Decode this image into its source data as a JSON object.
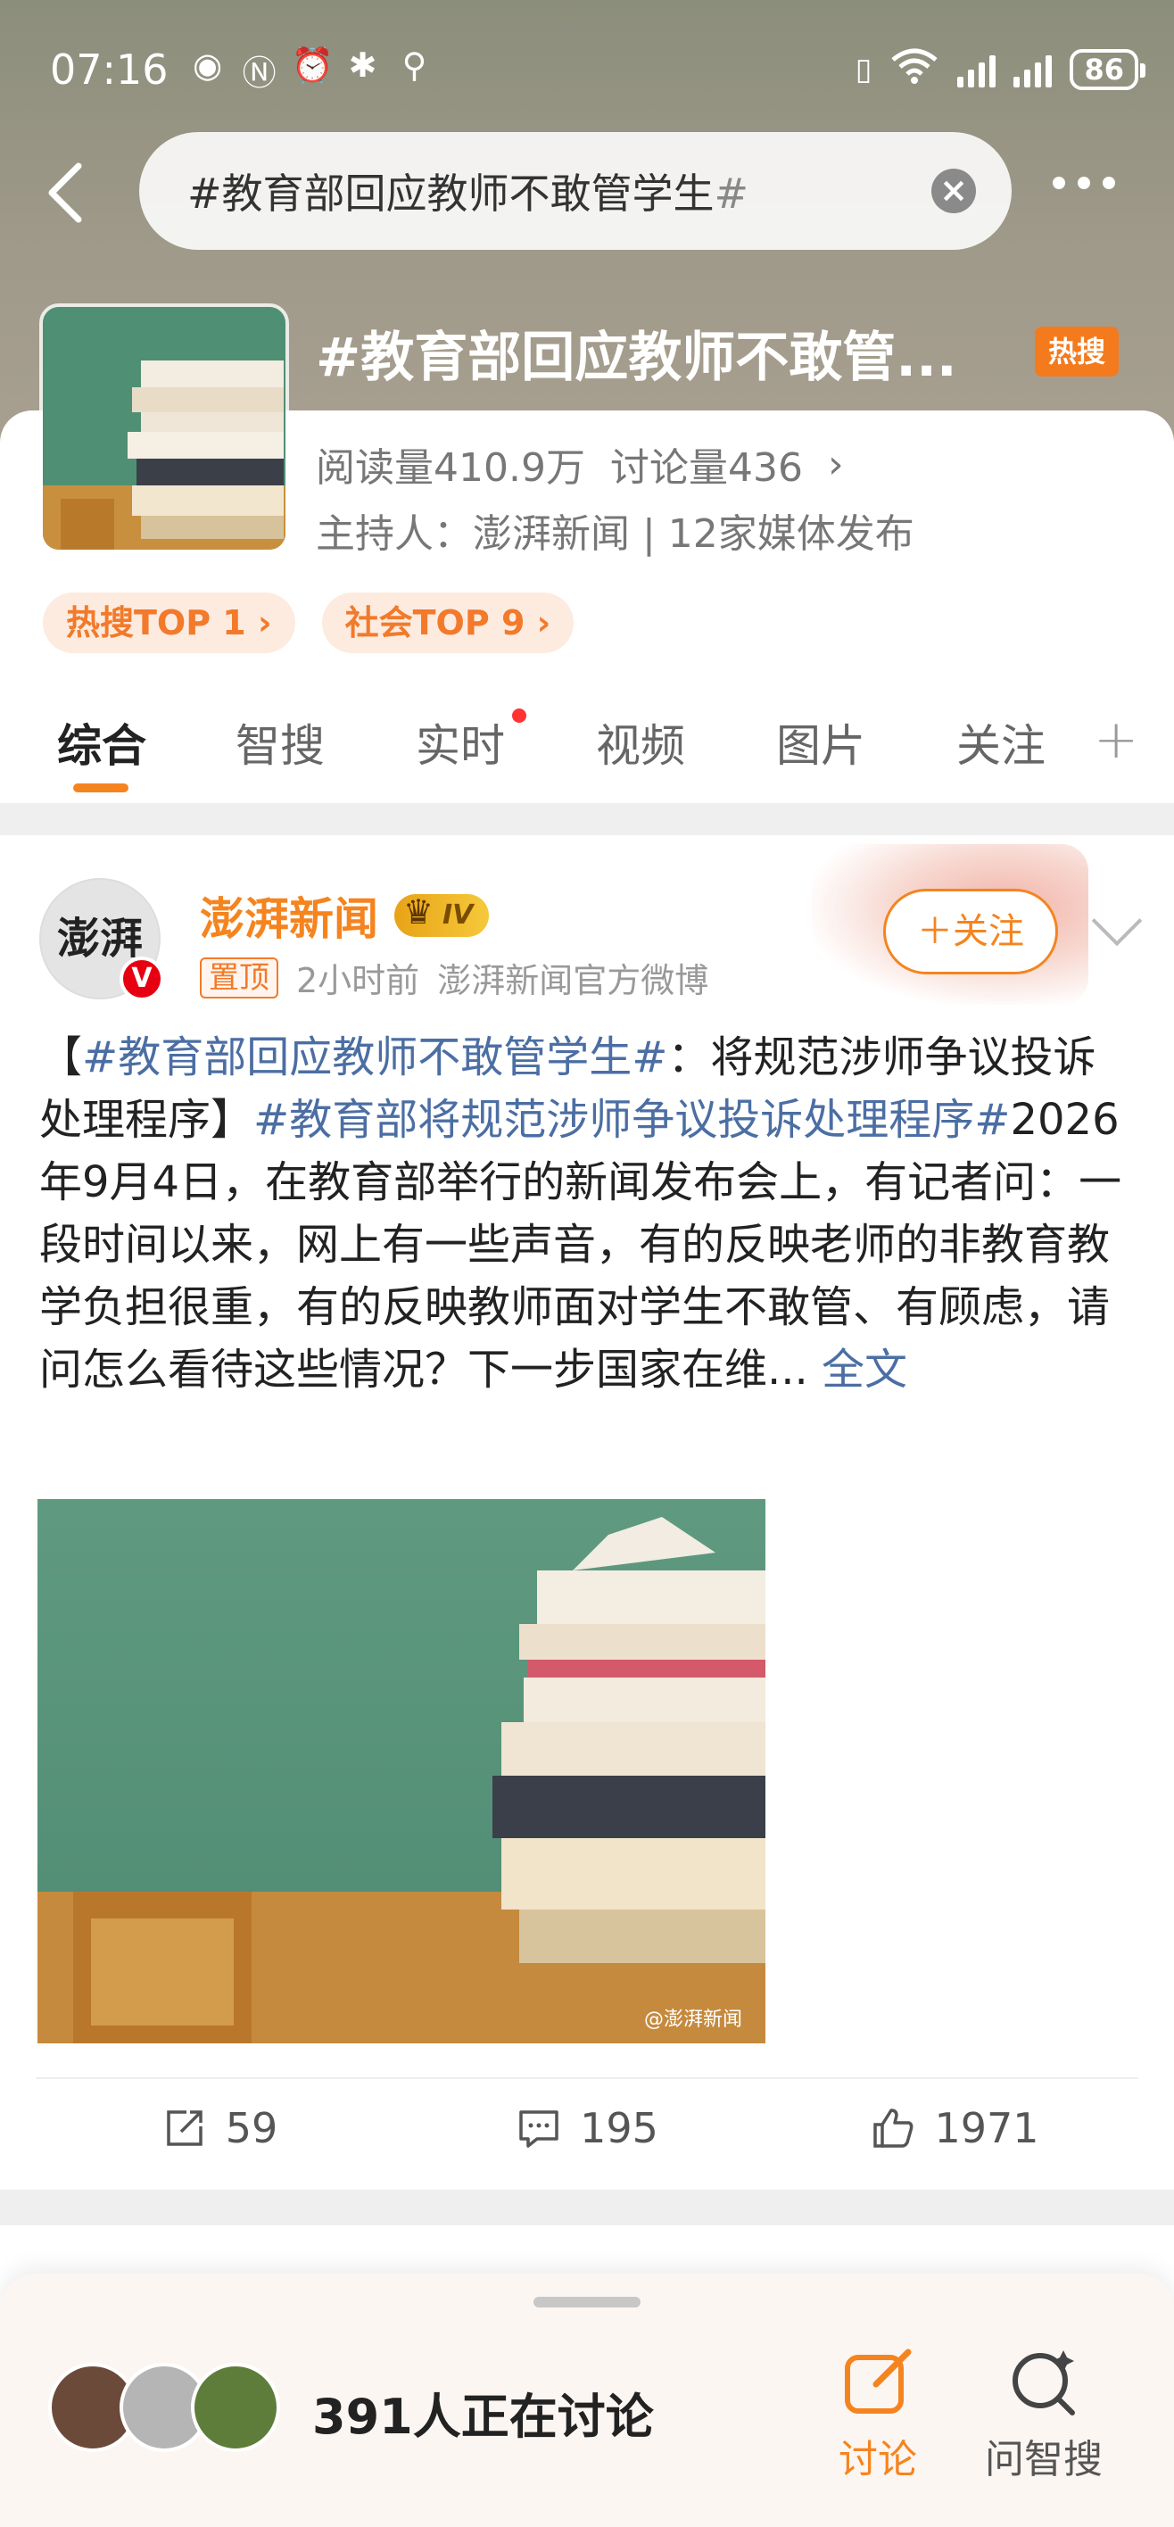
{
  "status_bar": {
    "time": "07:16",
    "battery": "86",
    "network": "6"
  },
  "search": {
    "text_main": "#教育部回应教师不敢管学生",
    "text_hash": "#"
  },
  "topic": {
    "title": "#教育部回应教师不敢管...",
    "hot_badge": "热搜",
    "reads": "阅读量410.9万",
    "discussions": "讨论量436",
    "host": "主持人：澎湃新闻 | 12家媒体发布",
    "chips": [
      "热搜TOP 1 ›",
      "社会TOP 9 ›"
    ]
  },
  "tabs": [
    "综合",
    "智搜",
    "实时",
    "视频",
    "图片",
    "关注"
  ],
  "post": {
    "author": "澎湃新闻",
    "avatar_text": "澎湃",
    "verified": "V",
    "level": "IV",
    "pinned": "置顶",
    "time": "2小时前",
    "source": "澎湃新闻官方微博",
    "follow": "＋关注",
    "text": {
      "open": "【",
      "tag1": "#教育部回应教师不敢管学生#",
      "mid": "：将规范涉师争议投诉处理程序】",
      "tag2": "#教育部将规范涉师争议投诉处理程序#",
      "body": "2026年9月4日，在教育部举行的新闻发布会上，有记者问：一段时间以来，网上有一些声音，有的反映老师的非教育教学负担很重，有的反映教师面对学生不敢管、有顾虑，请问怎么看待这些情况？下一步国家在维...",
      "more": "全文"
    },
    "image_watermark": "@澎湃新闻",
    "reposts": "59",
    "comments": "195",
    "likes": "1971"
  },
  "bottom": {
    "discussing": "391人正在讨论",
    "discuss_btn": "讨论",
    "ai_btn": "问智搜"
  },
  "colors": {
    "accent": "#f5841f",
    "link": "#4b6ea3",
    "hot": "#f47a1e"
  }
}
